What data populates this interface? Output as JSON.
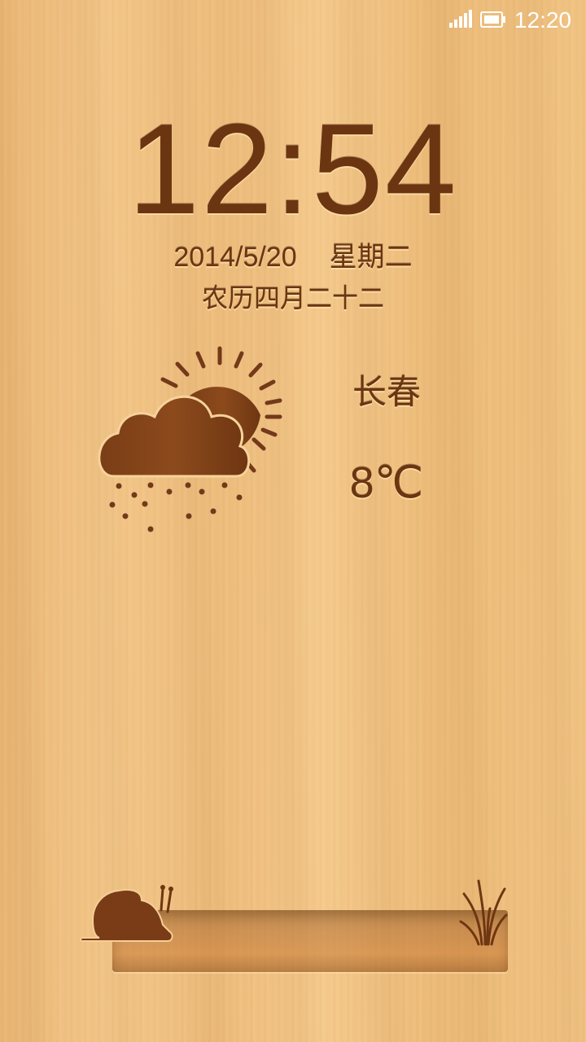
{
  "status_bar": {
    "time": "12:20",
    "icons": [
      "signal-icon",
      "battery-icon"
    ]
  },
  "lockscreen": {
    "clock": "12:54",
    "date": "2014/5/20",
    "weekday": "星期二",
    "lunar_date": "农历四月二十二"
  },
  "weather": {
    "icon": "cloud-sun-rain-icon",
    "city": "长春",
    "temperature": "8℃"
  },
  "decorations": [
    "snail-icon",
    "grass-icon",
    "wooden-shelf"
  ],
  "colors": {
    "engraved_text": "#6b3512",
    "wood_background": "#f1c383",
    "status_text": "#ffffff"
  }
}
